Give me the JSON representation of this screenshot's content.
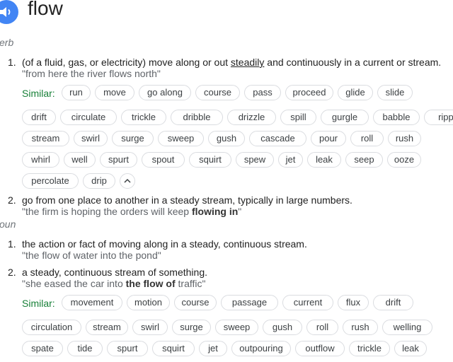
{
  "headword": "flow",
  "sections": [
    {
      "pos": "erb",
      "senses": [
        {
          "num": "1.",
          "definition_before": "(of a fluid, gas, or electricity) move along or out ",
          "definition_link": "steadily",
          "definition_after": " and continuously in a current or stream.",
          "example": "\"from here the river flows north\"",
          "similar_label": "Similar:",
          "chips": [
            [
              "run",
              "move",
              "go along",
              "course",
              "pass",
              "proceed",
              "glide",
              "slide"
            ],
            [
              "drift",
              "circulate",
              "trickle",
              "dribble",
              "drizzle",
              "spill",
              "gurgle",
              "babble",
              "ripple"
            ],
            [
              "stream",
              "swirl",
              "surge",
              "sweep",
              "gush",
              "cascade",
              "pour",
              "roll",
              "rush"
            ],
            [
              "whirl",
              "well",
              "spurt",
              "spout",
              "squirt",
              "spew",
              "jet",
              "leak",
              "seep",
              "ooze"
            ],
            [
              "percolate",
              "drip"
            ]
          ]
        },
        {
          "num": "2.",
          "definition": "go from one place to another in a steady stream, typically in large numbers.",
          "example_before": "\"the firm is hoping the orders will keep ",
          "example_bold": "flowing in",
          "example_after": "\""
        }
      ]
    },
    {
      "pos": "oun",
      "senses": [
        {
          "num": "1.",
          "definition": "the action or fact of moving along in a steady, continuous stream.",
          "example": "\"the flow of water into the pond\""
        },
        {
          "num": "2.",
          "definition": "a steady, continuous stream of something.",
          "example_before": "\"she eased the car into ",
          "example_bold": "the flow of",
          "example_after": " traffic\"",
          "similar_label": "Similar:",
          "chips": [
            [
              "movement",
              "motion",
              "course",
              "passage",
              "current",
              "flux",
              "drift"
            ],
            [
              "circulation",
              "stream",
              "swirl",
              "surge",
              "sweep",
              "gush",
              "roll",
              "rush",
              "welling"
            ],
            [
              "spate",
              "tide",
              "spurt",
              "squirt",
              "jet",
              "outpouring",
              "outflow",
              "trickle",
              "leak"
            ]
          ]
        }
      ]
    }
  ]
}
